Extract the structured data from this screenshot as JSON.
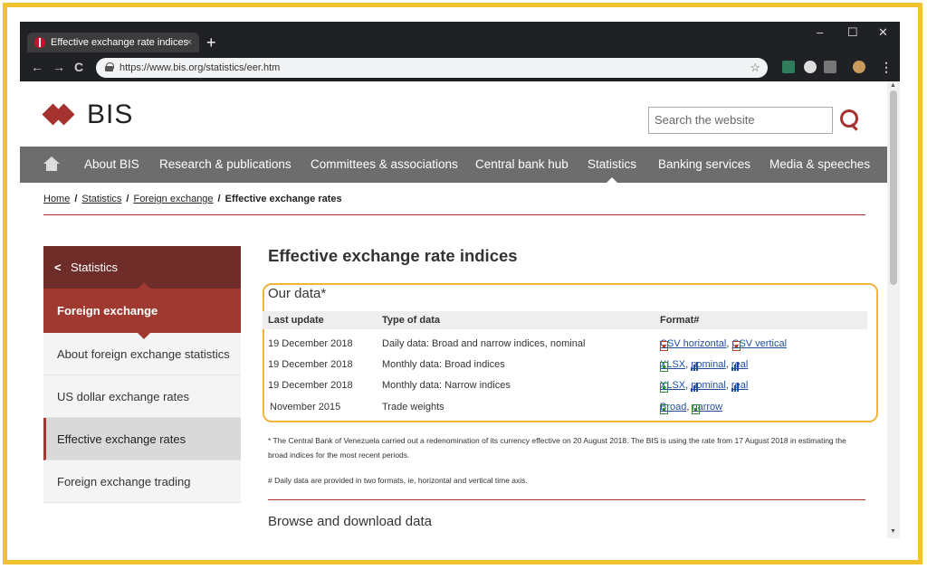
{
  "browser": {
    "tab_title": "Effective exchange rate indices",
    "tab_close": "×",
    "new_tab": "+",
    "url": "https://www.bis.org/statistics/eer.htm",
    "minimize": "–",
    "maximize": "☐",
    "close": "✕"
  },
  "header": {
    "logo_text": "BIS",
    "search_placeholder": "Search the website"
  },
  "nav": {
    "items": [
      "About BIS",
      "Research & publications",
      "Committees & associations",
      "Central bank hub",
      "Statistics",
      "Banking services",
      "Media & speeches"
    ],
    "active": "Statistics"
  },
  "breadcrumb": {
    "items": [
      "Home",
      "Statistics",
      "Foreign exchange"
    ],
    "current": "Effective exchange rates",
    "sep": "/"
  },
  "sidebar": {
    "head": "Statistics",
    "selected_section": "Foreign exchange",
    "items": [
      "About foreign exchange statistics",
      "US dollar exchange rates",
      "Effective exchange rates",
      "Foreign exchange trading"
    ],
    "current": "Effective exchange rates"
  },
  "main": {
    "title": "Effective exchange rate indices",
    "section_title": "Our data*",
    "columns": [
      "Last update",
      "Type of data",
      "Format#"
    ],
    "rows": [
      {
        "date": "19 December 2018",
        "type": "Daily data: Broad and narrow indices, nominal",
        "links": [
          "CSV horizontal",
          "CSV vertical"
        ]
      },
      {
        "date": "19 December 2018",
        "type": "Monthly data: Broad indices",
        "links": [
          "XLSX",
          "nominal",
          "real"
        ]
      },
      {
        "date": "19 December 2018",
        "type": "Monthly data: Narrow indices",
        "links": [
          "XLSX",
          "nominal",
          "real"
        ]
      },
      {
        "date": "November 2015",
        "type": "Trade weights",
        "links": [
          "Broad",
          "narrow"
        ]
      }
    ],
    "note1": "* The Central Bank of Venezuela carried out a redenomination of its currency effective on 20 August 2018. The BIS is using the rate from 17 August 2018 in estimating the broad indices for the most recent periods.",
    "note2": "# Daily data are provided in two formats, ie, horizontal and vertical time axis.",
    "browse_title": "Browse and download data"
  }
}
